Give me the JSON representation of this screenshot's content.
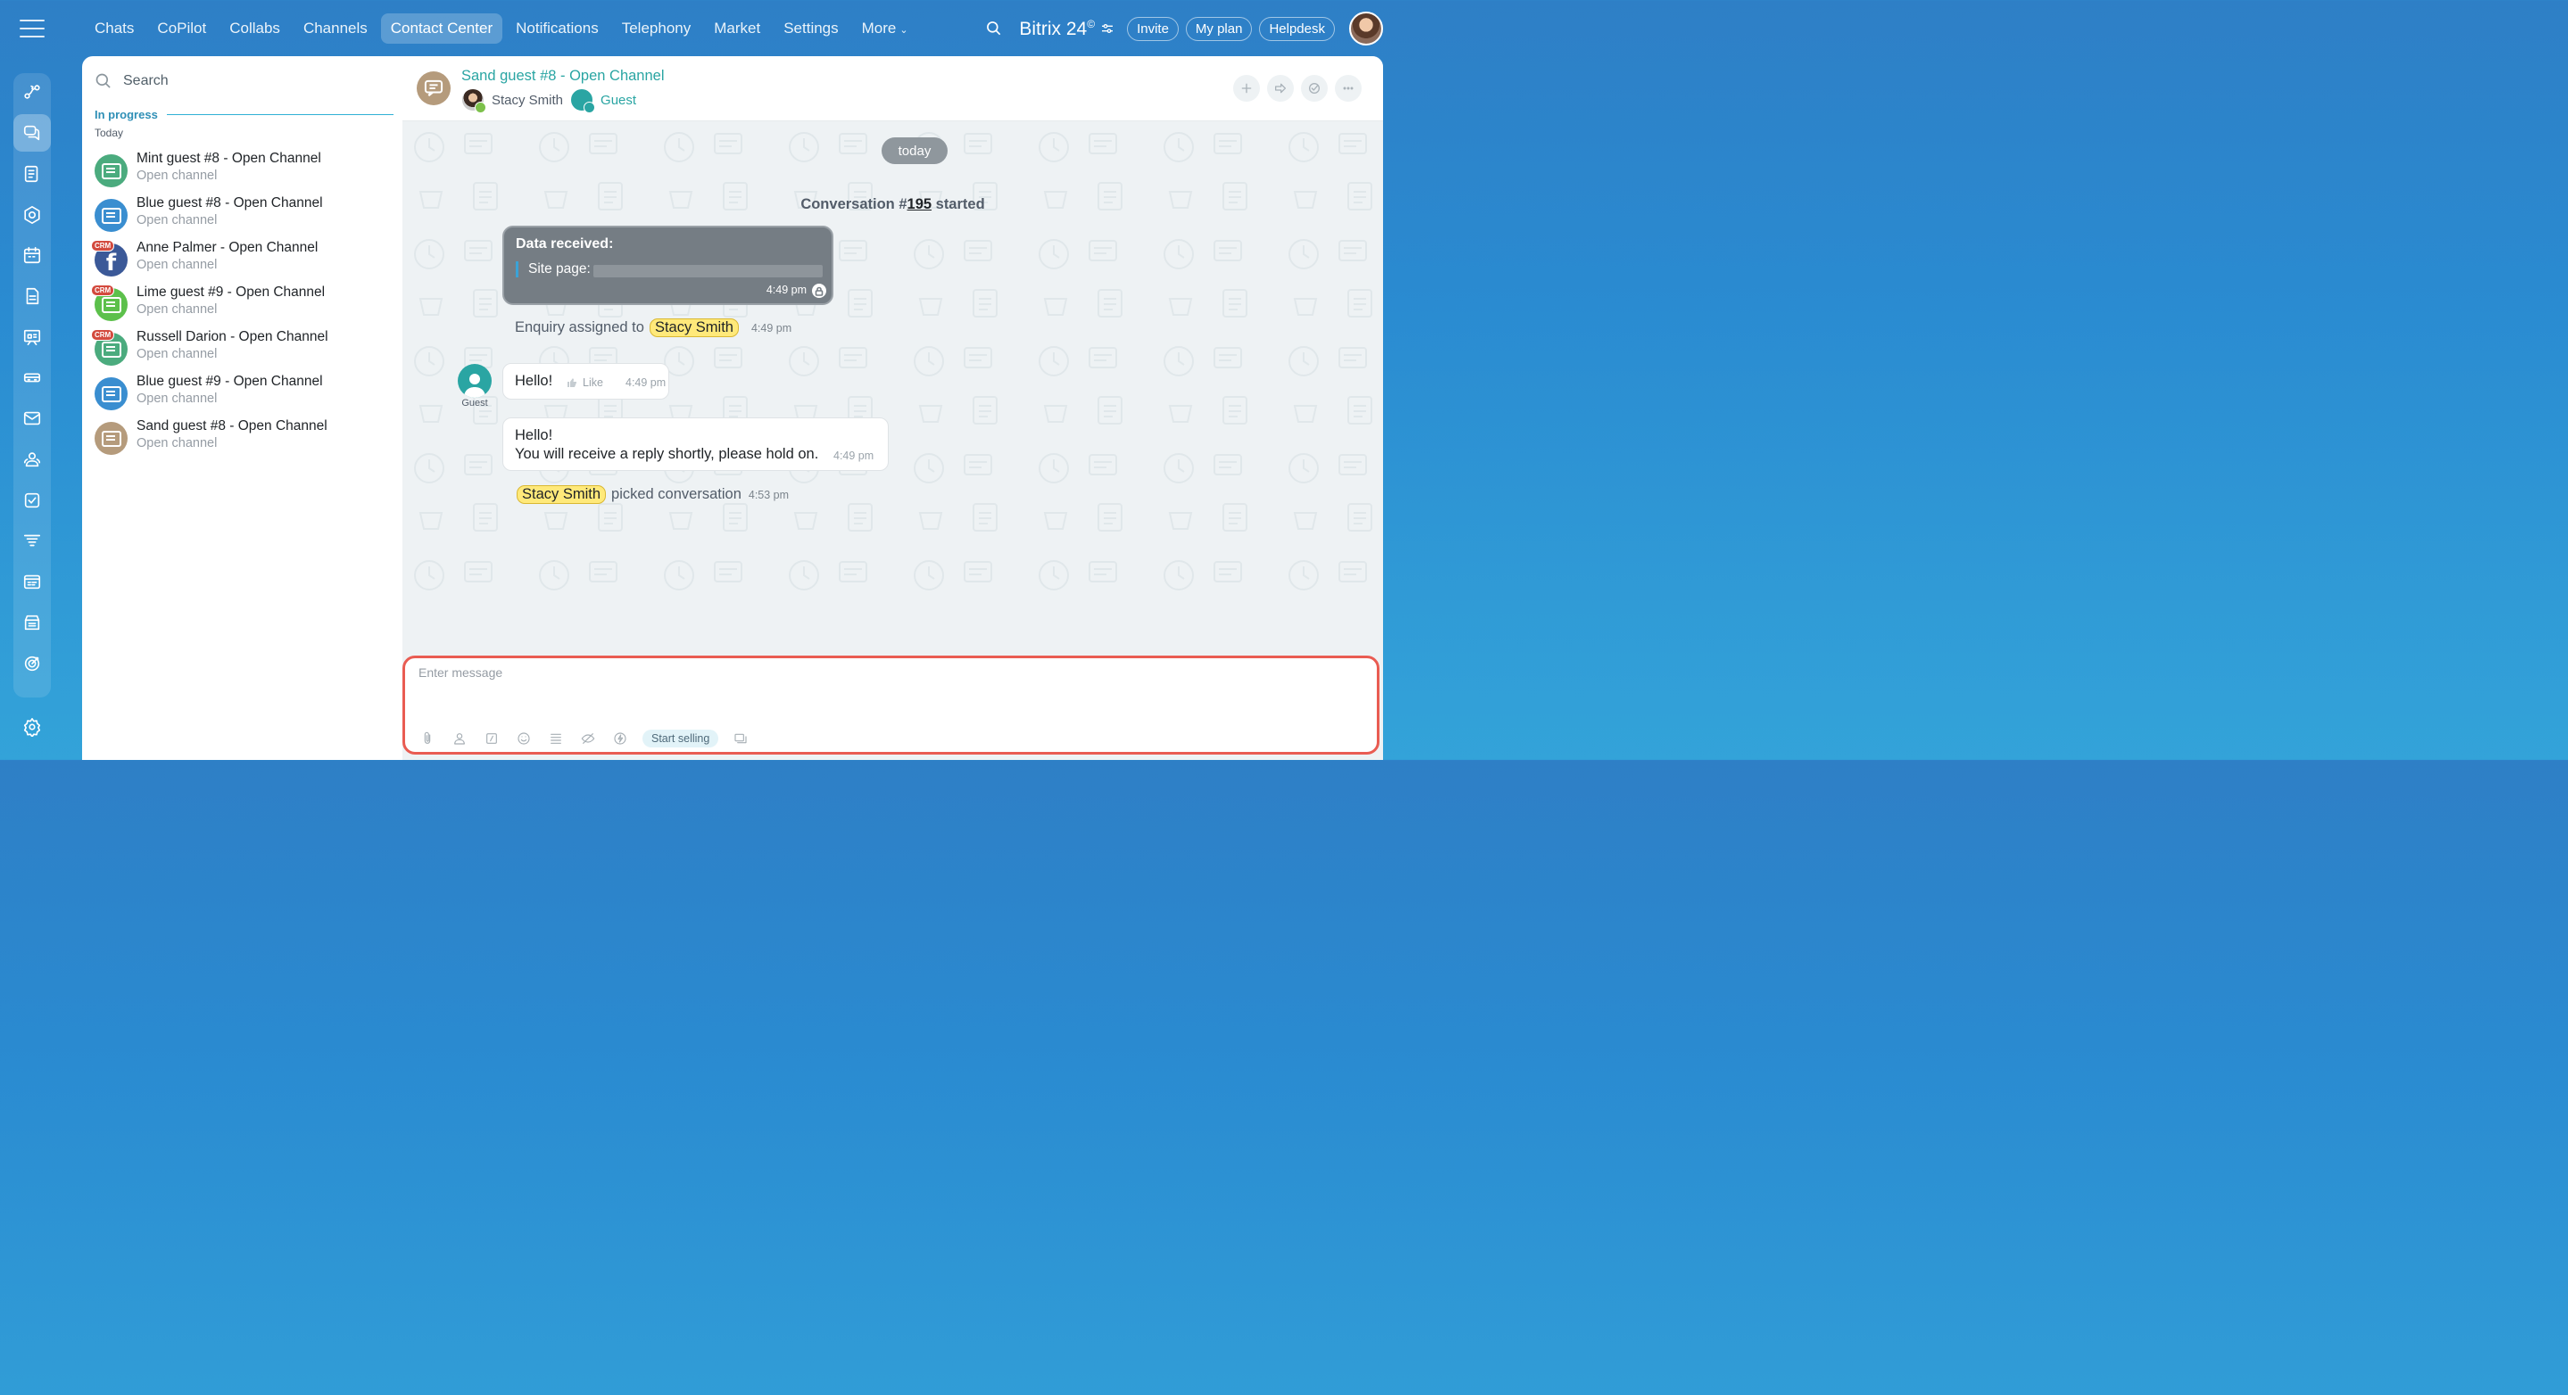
{
  "app": {
    "brand": "Bitrix 24",
    "brand_mark": "©"
  },
  "topnav": {
    "items": [
      {
        "label": "Chats"
      },
      {
        "label": "CoPilot"
      },
      {
        "label": "Collabs"
      },
      {
        "label": "Channels"
      },
      {
        "label": "Contact Center",
        "active": true
      },
      {
        "label": "Notifications"
      },
      {
        "label": "Telephony"
      },
      {
        "label": "Market"
      },
      {
        "label": "Settings"
      },
      {
        "label": "More"
      }
    ],
    "invite": "Invite",
    "my_plan": "My plan",
    "helpdesk": "Helpdesk"
  },
  "sidebar": {
    "icons": [
      "menu-icon",
      "flows-icon",
      "messenger-icon",
      "feed-icon",
      "hexagon-icon",
      "calendar-icon",
      "docs-icon",
      "board-icon",
      "car-icon",
      "mail-icon",
      "contacts-icon",
      "tasks-icon",
      "filter-icon",
      "timeline-icon",
      "store-icon",
      "target-icon",
      "settings-icon"
    ]
  },
  "list": {
    "search_placeholder": "Search",
    "section": "In progress",
    "date_group": "Today",
    "chats": [
      {
        "name": "Mint guest #8 - Open Channel",
        "sub": "Open channel",
        "color": "#4bab7e",
        "crm": false,
        "fb": false
      },
      {
        "name": "Blue guest #8 - Open Channel",
        "sub": "Open channel",
        "color": "#3a8ed0",
        "crm": false,
        "fb": false
      },
      {
        "name": "Anne Palmer - Open Channel",
        "sub": "Open channel",
        "color": "#3b5998",
        "crm": true,
        "fb": true
      },
      {
        "name": "Lime guest #9 - Open Channel",
        "sub": "Open channel",
        "color": "#5cc04b",
        "crm": true,
        "fb": false
      },
      {
        "name": "Russell Darion - Open Channel",
        "sub": "Open channel",
        "color": "#4bab7e",
        "crm": true,
        "fb": false
      },
      {
        "name": "Blue guest #9 - Open Channel",
        "sub": "Open channel",
        "color": "#3a8ed0",
        "crm": false,
        "fb": false
      },
      {
        "name": "Sand guest #8 - Open Channel",
        "sub": "Open channel",
        "color": "#b59b7c",
        "crm": false,
        "fb": false
      }
    ],
    "crm_badge": "CRM",
    "fb_glyph": "f"
  },
  "chat": {
    "title": "Sand guest #8 - Open Channel",
    "operator": "Stacy Smith",
    "guest": "Guest",
    "date_chip": "today",
    "conv_prefix": "Conversation #",
    "conv_number": "195",
    "conv_suffix": "started",
    "data_card": {
      "title": "Data received:",
      "site_label": "Site page:",
      "time": "4:49 pm"
    },
    "assigned": {
      "text": "Enquiry assigned to",
      "user": "Stacy Smith",
      "time": "4:49 pm"
    },
    "guest_label": "Guest",
    "msg1": {
      "text": "Hello!",
      "like": "Like",
      "time": "4:49 pm"
    },
    "msg2": {
      "line1": "Hello!",
      "line2": "You will receive a reply shortly, please hold on.",
      "time": "4:49 pm"
    },
    "picked": {
      "user": "Stacy Smith",
      "text": "picked conversation",
      "time": "4:53 pm"
    }
  },
  "composer": {
    "placeholder": "Enter message",
    "start_selling": "Start selling"
  },
  "colors": {
    "accent": "#2aa5a3",
    "highlight": "#ffe97a",
    "composer_border": "#e95c52"
  }
}
